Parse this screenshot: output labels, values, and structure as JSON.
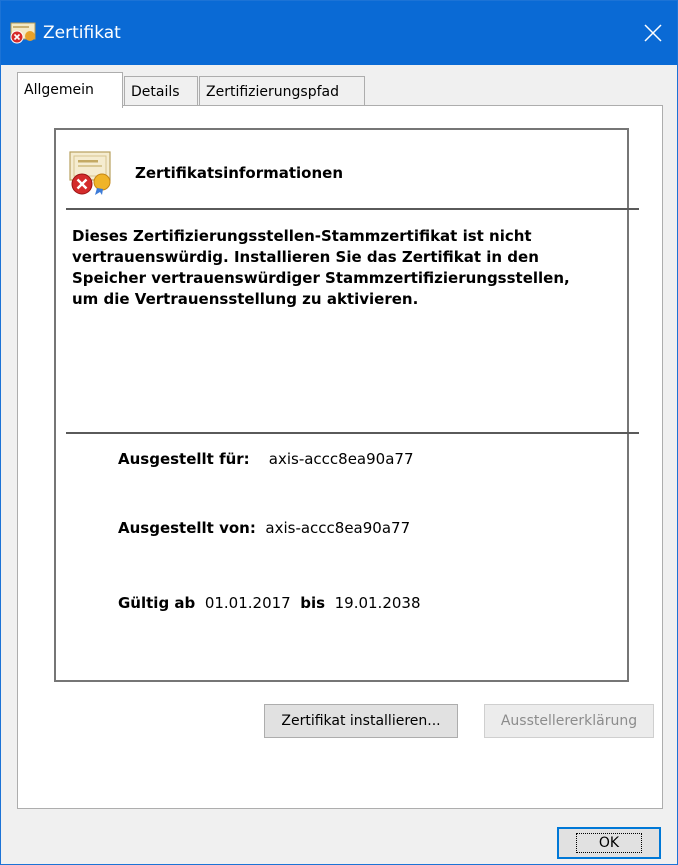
{
  "window": {
    "title": "Zertifikat",
    "close_label": "close"
  },
  "tabs": [
    {
      "label": "Allgemein",
      "active": true
    },
    {
      "label": "Details",
      "active": false
    },
    {
      "label": "Zertifizierungspfad",
      "active": false
    }
  ],
  "info": {
    "title": "Zertifikatsinformationen",
    "warning": "Dieses Zertifizierungsstellen-Stammzertifikat ist nicht vertrauenswürdig. Installieren Sie das Zertifikat in den Speicher vertrauenswürdiger Stammzertifizierungsstellen, um die Vertrauensstellung zu aktivieren.",
    "issued_to_label": "Ausgestellt für:",
    "issued_to_value": "axis-accc8ea90a77",
    "issued_by_label": "Ausgestellt von:",
    "issued_by_value": "axis-accc8ea90a77",
    "valid_from_label": "Gültig ab",
    "valid_from_value": "01.01.2017",
    "valid_to_label": "bis",
    "valid_to_value": "19.01.2038"
  },
  "buttons": {
    "install": "Zertifikat installieren...",
    "issuer_statement": "Ausstellererklärung",
    "ok": "OK"
  },
  "colors": {
    "titlebar": "#0a6ad5",
    "annotation_arrow": "#e81c1c",
    "focus_border": "#0078d7"
  },
  "icons": [
    "certificate-error-icon",
    "close-icon",
    "red-arrow-annotation"
  ]
}
